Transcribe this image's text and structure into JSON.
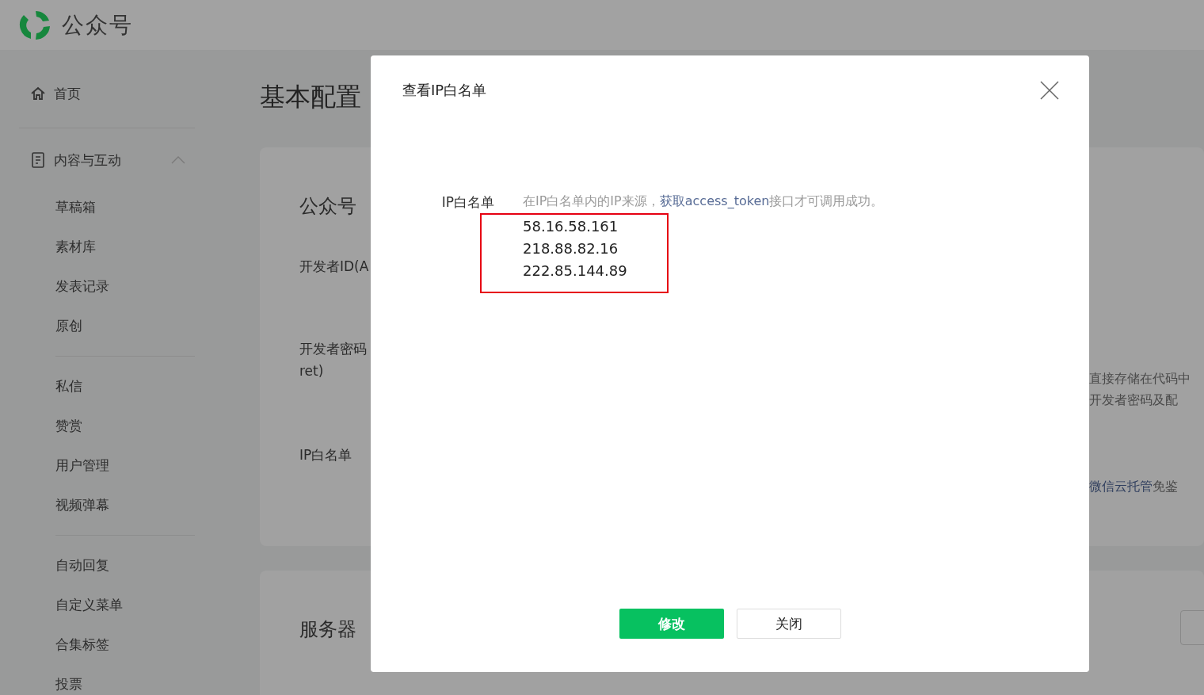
{
  "header": {
    "brand": "公众号"
  },
  "sidebar": {
    "groups": [
      {
        "items": [
          {
            "label": "首页",
            "kind": "home"
          }
        ]
      },
      {
        "items": [
          {
            "label": "内容与互动",
            "kind": "section",
            "expanded": true
          },
          {
            "label": "草稿箱",
            "kind": "sub"
          },
          {
            "label": "素材库",
            "kind": "sub"
          },
          {
            "label": "发表记录",
            "kind": "sub"
          },
          {
            "label": "原创",
            "kind": "sub"
          }
        ]
      },
      {
        "items": [
          {
            "label": "私信",
            "kind": "sub"
          },
          {
            "label": "赞赏",
            "kind": "sub"
          },
          {
            "label": "用户管理",
            "kind": "sub"
          },
          {
            "label": "视频弹幕",
            "kind": "sub"
          }
        ]
      },
      {
        "items": [
          {
            "label": "自动回复",
            "kind": "sub"
          },
          {
            "label": "自定义菜单",
            "kind": "sub"
          },
          {
            "label": "合集标签",
            "kind": "sub"
          },
          {
            "label": "投票",
            "kind": "sub"
          }
        ]
      }
    ]
  },
  "page": {
    "title": "基本配置",
    "card_1": {
      "title": "公众号",
      "rows": [
        {
          "label": "开发者ID(A"
        },
        {
          "label": "开发者密码",
          "label_2": "ret)",
          "notes": [
            "直接存储在代码中",
            "开发者密码及配"
          ]
        },
        {
          "label": "IP白名单",
          "note": {
            "link": "微信云托管",
            "after": "免鉴"
          }
        }
      ]
    },
    "card_2": {
      "title": "服务器"
    }
  },
  "dialog": {
    "title": "查看IP白名单",
    "field_label": "IP白名单",
    "note": {
      "before": "在IP白名单内的IP来源，",
      "link": "获取access_token",
      "after": "接口才可调用成功。"
    },
    "ips": [
      "58.16.58.161",
      "218.88.82.16",
      "222.85.144.89"
    ],
    "buttons": [
      {
        "label": "修改",
        "kind": "primary"
      },
      {
        "label": "关闭",
        "kind": "default"
      }
    ]
  }
}
